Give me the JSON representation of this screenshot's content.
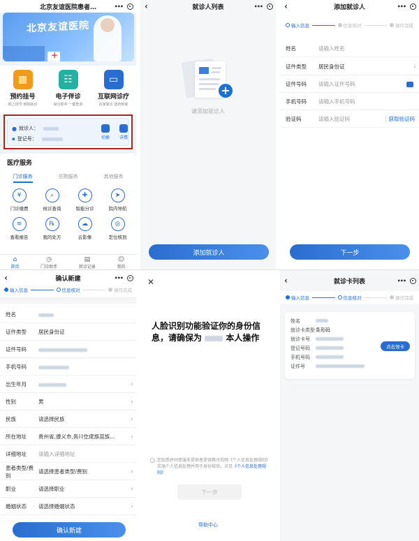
{
  "home": {
    "title": "北京友谊医院患者…",
    "banner_title": "北京友谊医院",
    "quick": [
      {
        "label": "预约挂号",
        "sub": "网上挂号 到院就诊",
        "color": "#f29a1d",
        "icon": "calendar-icon"
      },
      {
        "label": "电子伴诊",
        "sub": "就诊助手 一键查询",
        "color": "#24b0a3",
        "icon": "guide-icon"
      },
      {
        "label": "互联网诊疗",
        "sub": "在家复诊 送药到家",
        "color": "#2a6dd0",
        "icon": "monitor-icon"
      }
    ],
    "patient_label": "就诊人：",
    "register_label": "登记号：",
    "switch_label": "切换",
    "detail_label": "详情",
    "services_title": "医疗服务",
    "tabs": [
      "门诊服务",
      "住院服务",
      "其他服务"
    ],
    "grid": [
      {
        "label": "门诊缴费",
        "glyph": "¥"
      },
      {
        "label": "候诊查询",
        "glyph": "⌕"
      },
      {
        "label": "智能分诊",
        "glyph": "✚"
      },
      {
        "label": "院内导航",
        "glyph": "➤"
      },
      {
        "label": "查看报告",
        "glyph": "≡"
      },
      {
        "label": "我的处方",
        "glyph": "℞"
      },
      {
        "label": "云影像",
        "glyph": "☁"
      },
      {
        "label": "定位核到",
        "glyph": "◎"
      }
    ],
    "tabbar": [
      {
        "label": "首页",
        "glyph": "⌂"
      },
      {
        "label": "门诊助手",
        "glyph": "◷"
      },
      {
        "label": "就诊记录",
        "glyph": "▤"
      },
      {
        "label": "我的",
        "glyph": "☺"
      }
    ]
  },
  "patient_list": {
    "title": "就诊人列表",
    "empty_text": "请添加就诊人",
    "add_button": "添加就诊人"
  },
  "add_patient": {
    "title": "添加就诊人",
    "steps": [
      "输入信息",
      "信息核对",
      "操作完成"
    ],
    "fields": [
      {
        "label": "姓名",
        "value": "请输入姓名"
      },
      {
        "label": "证件类型",
        "value": "居民身份证"
      },
      {
        "label": "证件号码",
        "value": "请输入证件号码"
      },
      {
        "label": "手机号码",
        "value": "请输入手机号码"
      },
      {
        "label": "验证码",
        "value": "请输入验证码"
      }
    ],
    "get_code": "获取验证码",
    "next_button": "下一步"
  },
  "confirm_new": {
    "title": "确认新建",
    "steps": [
      "输入信息",
      "信息核对",
      "操作完成"
    ],
    "fields": [
      {
        "label": "姓名",
        "value": ""
      },
      {
        "label": "证件类型",
        "value": "居民身份证"
      },
      {
        "label": "证件号码",
        "value": ""
      },
      {
        "label": "手机号码",
        "value": ""
      },
      {
        "label": "出生年月",
        "value": ""
      },
      {
        "label": "性别",
        "value": "男"
      },
      {
        "label": "民族",
        "value": "请选择民族"
      },
      {
        "label": "所在地址",
        "value": "贵州省,遵义市,务川仡佬族苗族..."
      },
      {
        "label": "详细地址",
        "value": "请输入详细地址"
      },
      {
        "label": "患者类型/费别",
        "value": "请选择患者类型/费别"
      },
      {
        "label": "职业",
        "value": "请选择职业"
      },
      {
        "label": "婚姻状态",
        "value": "请选择婚姻状态"
      }
    ],
    "confirm_button": "确认新建"
  },
  "face_verify": {
    "title_line1": "人脸识别功能验证你的身份信",
    "title_line2a": "息，请确保为",
    "title_line2b": "本人操作",
    "agree_text": "您知悉并同意服务提供者提供腾讯视频《个人信息处理规则》实施个人信息处理并用于身份核验，详见",
    "agree_link": "《个人信息处理规则》",
    "next_button": "下一步",
    "help": "帮助中心"
  },
  "card_list": {
    "title": "就诊卡列表",
    "steps": [
      "输入信息",
      "信息核对",
      "操作完成"
    ],
    "rows": [
      {
        "label": "姓名",
        "value": ""
      },
      {
        "label": "就诊卡类型",
        "value": "条形码"
      },
      {
        "label": "就诊卡号",
        "value": ""
      },
      {
        "label": "登记号码",
        "value": ""
      },
      {
        "label": "手机号码",
        "value": ""
      },
      {
        "label": "证件号",
        "value": ""
      }
    ],
    "get_card": "点击领卡"
  }
}
